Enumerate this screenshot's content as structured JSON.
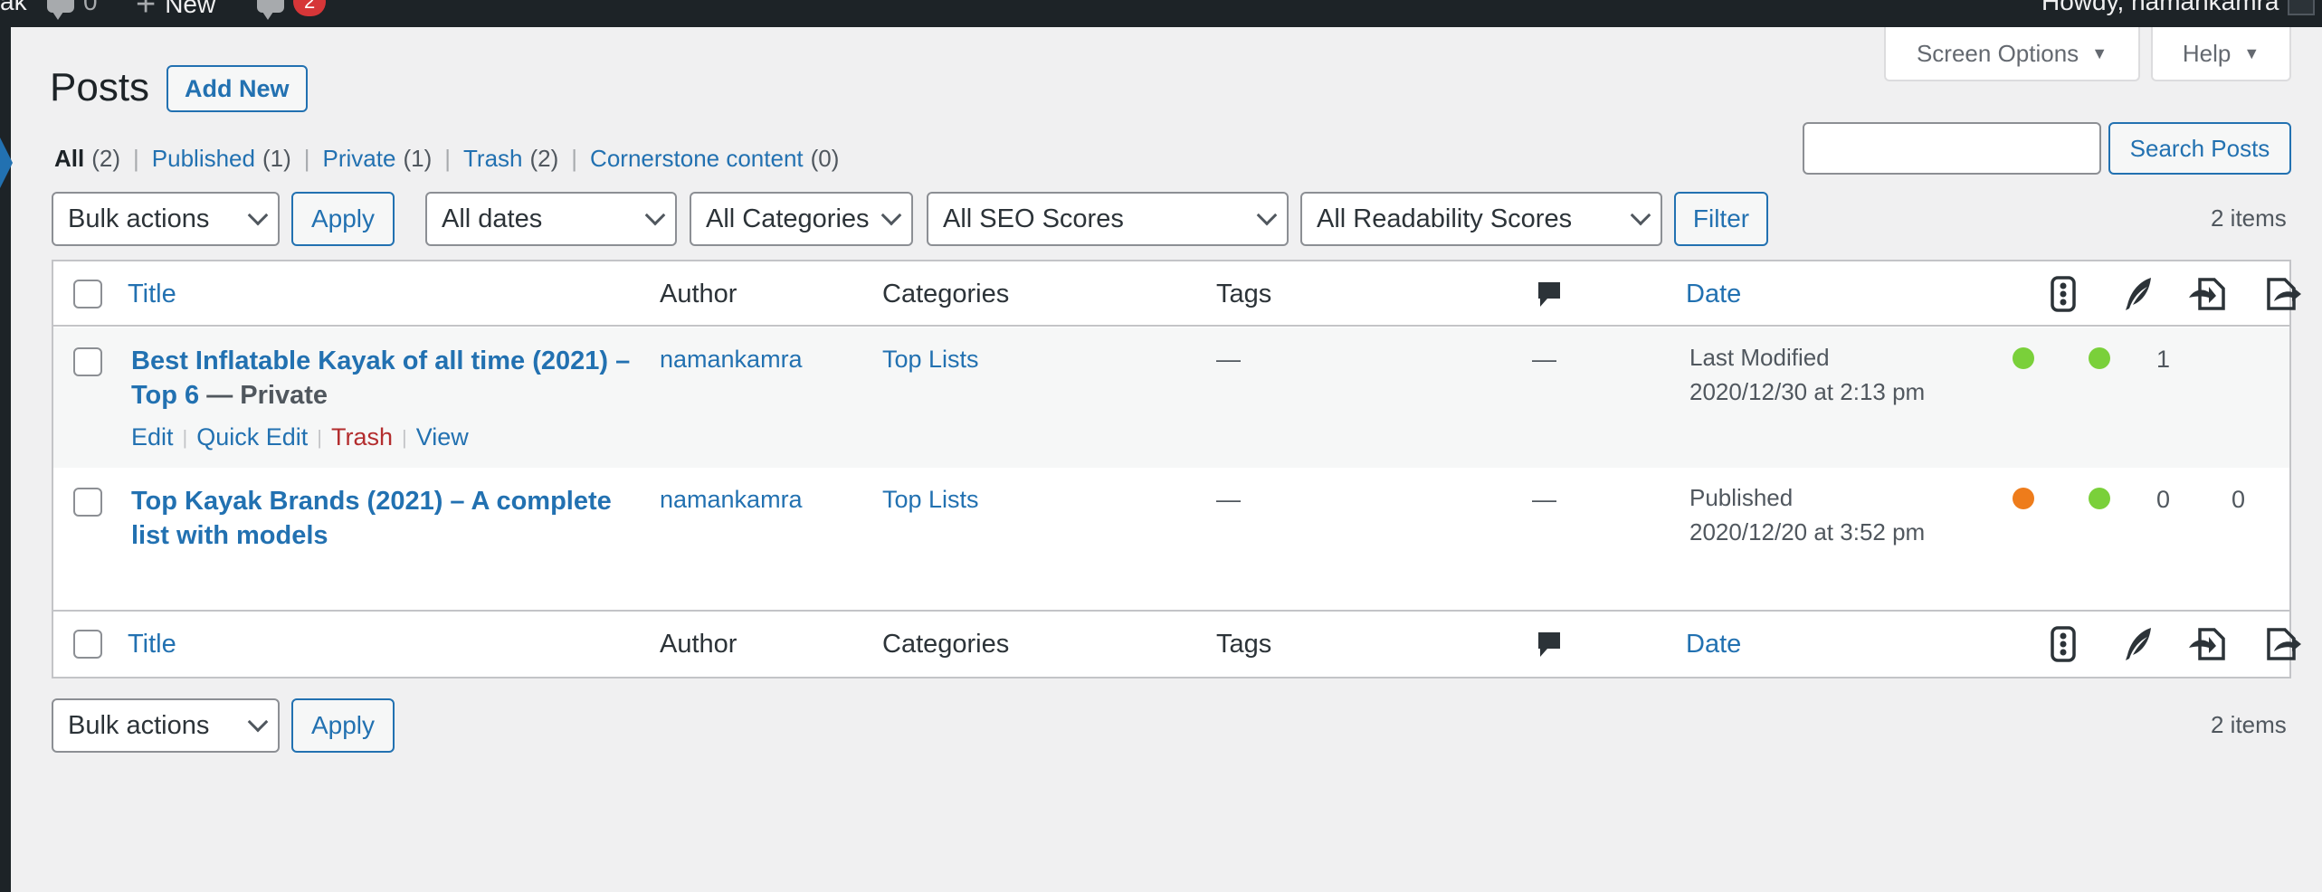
{
  "admin_bar": {
    "site_fragment": "ak",
    "comments_count": "0",
    "new_label": "New",
    "updates_badge": "2",
    "howdy": "Howdy, namankamra"
  },
  "screen_meta": {
    "screen_options": "Screen Options",
    "help": "Help"
  },
  "heading": {
    "title": "Posts",
    "add_new": "Add New"
  },
  "views": [
    {
      "label": "All",
      "count": "(2)"
    },
    {
      "label": "Published",
      "count": "(1)"
    },
    {
      "label": "Private",
      "count": "(1)"
    },
    {
      "label": "Trash",
      "count": "(2)"
    },
    {
      "label": "Cornerstone content",
      "count": "(0)"
    }
  ],
  "search": {
    "value": "",
    "button": "Search Posts"
  },
  "filters": {
    "bulk_actions": "Bulk actions",
    "apply": "Apply",
    "dates": "All dates",
    "categories": "All Categories",
    "seo_scores": "All SEO Scores",
    "readability_scores": "All Readability Scores",
    "filter": "Filter"
  },
  "items_count": "2 items",
  "columns": {
    "title": "Title",
    "author": "Author",
    "categories": "Categories",
    "tags": "Tags",
    "date": "Date",
    "comments_icon": "comment-bubble-icon",
    "seo_icon": "traffic-light-icon",
    "readability_icon": "feather-icon",
    "links_icon": "incoming-links-icon",
    "outgoing_icon": "outgoing-links-icon"
  },
  "posts": [
    {
      "title_line1": "Best Inflatable Kayak of all time (2021) –",
      "title_line2": "Top 6",
      "state": "— Private",
      "author": "namankamra",
      "category": "Top Lists",
      "tags": "—",
      "comments": "—",
      "date_status": "Last Modified",
      "date_value": "2020/12/30 at 2:13 pm",
      "seo_color": "#7ad03a",
      "readability_color": "#7ad03a",
      "links_in": "1",
      "links_out": "",
      "actions": [
        "Edit",
        "Quick Edit",
        "Trash",
        "View"
      ]
    },
    {
      "title_line1": "Top Kayak Brands (2021) – A complete",
      "title_line2": "list with models",
      "state": "",
      "author": "namankamra",
      "category": "Top Lists",
      "tags": "—",
      "comments": "—",
      "date_status": "Published",
      "date_value": "2020/12/20 at 3:52 pm",
      "seo_color": "#ee7c1b",
      "readability_color": "#7ad03a",
      "links_in": "0",
      "links_out": "0"
    }
  ]
}
